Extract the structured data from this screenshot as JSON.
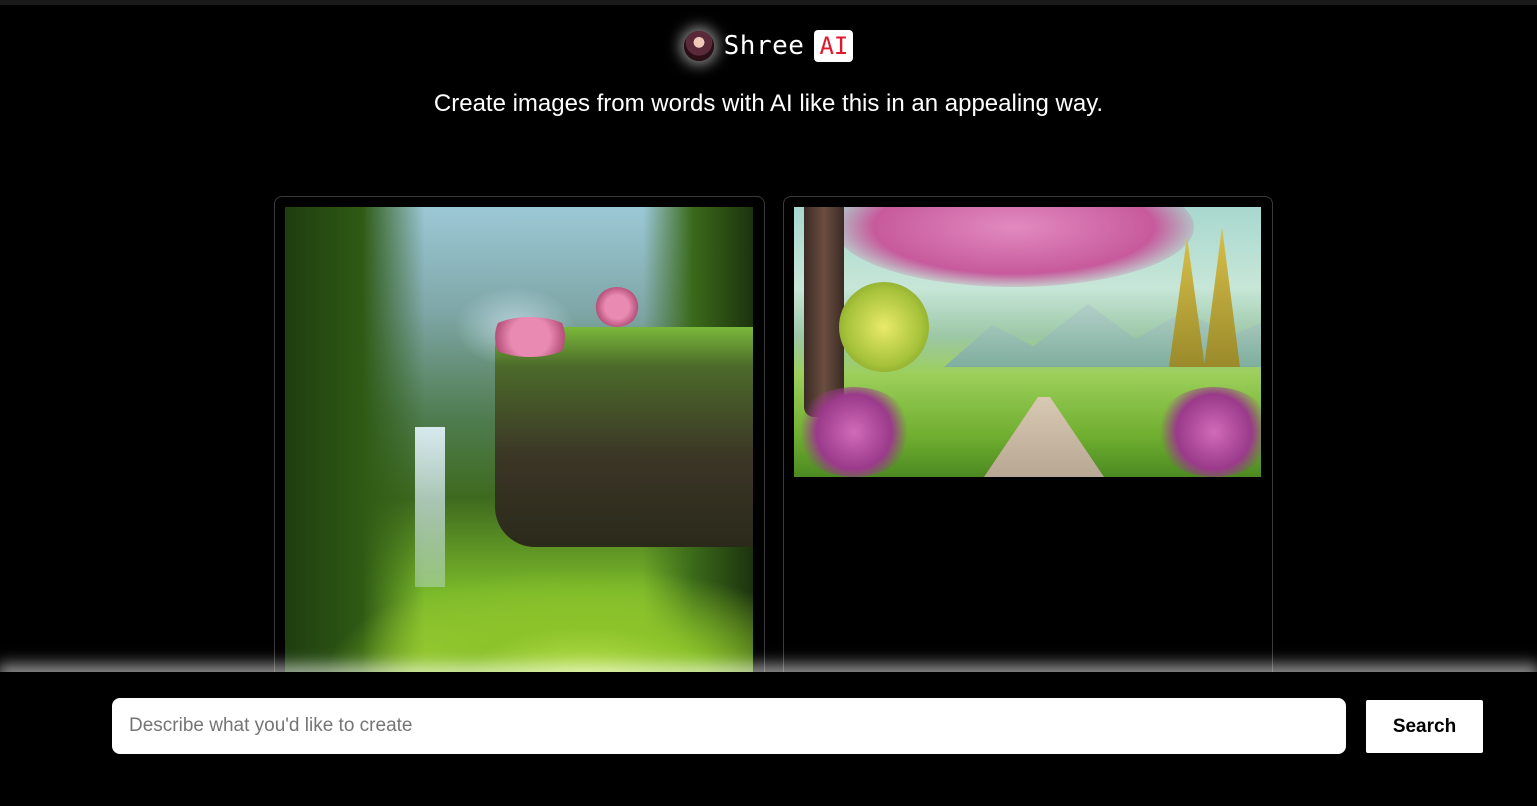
{
  "header": {
    "brand_name": "Shree",
    "brand_badge": "AI",
    "avatar_icon": "avatar-icon",
    "tagline": "Create images from words with AI like this in an appealing way."
  },
  "gallery": {
    "images": [
      {
        "icon": "fantasy-forest-waterfall-image"
      },
      {
        "icon": "blossom-meadow-path-image"
      }
    ]
  },
  "search": {
    "placeholder": "Describe what you'd like to create",
    "value": "",
    "button_label": "Search"
  },
  "colors": {
    "background": "#000000",
    "badge_text": "#e0182d",
    "button_bg": "#ffffff"
  }
}
